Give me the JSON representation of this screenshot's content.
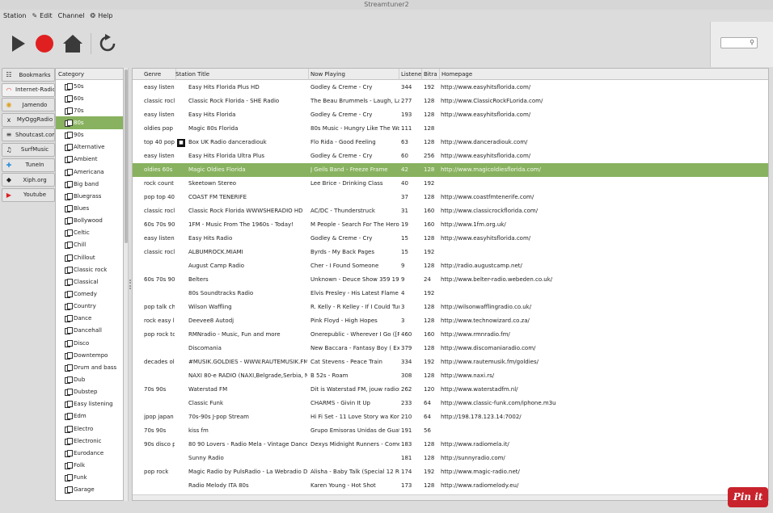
{
  "window": {
    "title": "Streamtuner2"
  },
  "menu": [
    {
      "label": "Station",
      "icon": ""
    },
    {
      "label": "Edit",
      "icon": "edit-icon"
    },
    {
      "label": "Channel",
      "icon": ""
    },
    {
      "label": "Help",
      "icon": "help-icon"
    }
  ],
  "toolbar": {
    "play_icon": "play-icon",
    "record_icon": "record-icon",
    "home_icon": "home-icon",
    "reload_icon": "reload-icon"
  },
  "search": {
    "value": ""
  },
  "sidebar": {
    "items": [
      {
        "label": "Bookmarks",
        "icon": "bookmarks-icon",
        "glyph": "☷"
      },
      {
        "label": "Internet-Radio",
        "icon": "internet-radio-icon",
        "glyph": "◠"
      },
      {
        "label": "Jamendo",
        "icon": "jamendo-icon",
        "glyph": "◉"
      },
      {
        "label": "MyOggRadio",
        "icon": "myoggradio-icon",
        "glyph": "x"
      },
      {
        "label": "Shoutcast.com",
        "icon": "shoutcast-icon",
        "glyph": "≡"
      },
      {
        "label": "SurfMusic",
        "icon": "surfmusic-icon",
        "glyph": "♫"
      },
      {
        "label": "TuneIn",
        "icon": "tunein-icon",
        "glyph": "✚"
      },
      {
        "label": "Xiph.org",
        "icon": "xiph-icon",
        "glyph": "◆"
      },
      {
        "label": "Youtube",
        "icon": "youtube-icon",
        "glyph": "▶"
      }
    ]
  },
  "categories": {
    "header": "Category",
    "items": [
      "50s",
      "60s",
      "70s",
      "80s",
      "90s",
      "Alternative",
      "Ambient",
      "Americana",
      "Big band",
      "Bluegrass",
      "Blues",
      "Bollywood",
      "Celtic",
      "Chill",
      "Chillout",
      "Classic rock",
      "Classical",
      "Comedy",
      "Country",
      "Dance",
      "Dancehall",
      "Disco",
      "Downtempo",
      "Drum and bass",
      "Dub",
      "Dubstep",
      "Easy listening",
      "Edm",
      "Electro",
      "Electronic",
      "Eurodance",
      "Folk",
      "Funk",
      "Garage"
    ],
    "selected": "80s"
  },
  "stations": {
    "columns": {
      "genre": "Genre",
      "title": "Station Title",
      "playing": "Now Playing",
      "listeners": "Listene",
      "bitrate": "Bitra",
      "homepage": "Homepage"
    },
    "rows": [
      {
        "genre": "easy listen",
        "title": "Easy Hits Florida Plus HD",
        "playing": "Godley & Creme - Cry",
        "listeners": "344",
        "bitrate": "192",
        "homepage": "http://www.easyhitsflorida.com/"
      },
      {
        "genre": "classic rocl",
        "title": "Classic Rock Florida - SHE Radio",
        "playing": "The Beau Brummels - Laugh, La",
        "listeners": "277",
        "bitrate": "128",
        "homepage": "http://www.ClassicRockFLorida.com/"
      },
      {
        "genre": "easy listen",
        "title": "Easy Hits Florida",
        "playing": "Godley & Creme - Cry",
        "listeners": "193",
        "bitrate": "128",
        "homepage": "http://www.easyhitsflorida.com/"
      },
      {
        "genre": "oldies pop",
        "title": "Magic 80s Florida",
        "playing": "80s Music - Hungry Like The Wol",
        "listeners": "111",
        "bitrate": "128",
        "homepage": ""
      },
      {
        "genre": "top 40 pop",
        "title": "Box UK Radio danceradiouk",
        "playing": "Flo Rida - Good Feeling",
        "listeners": "63",
        "bitrate": "128",
        "homepage": "http://www.danceradiouk.com/",
        "favicon": true
      },
      {
        "genre": "easy listen",
        "title": "Easy Hits Florida Ultra Plus",
        "playing": "Godley & Creme - Cry",
        "listeners": "60",
        "bitrate": "256",
        "homepage": "http://www.easyhitsflorida.com/"
      },
      {
        "genre": "oldies 60s",
        "title": "Magic Oldies Florida",
        "playing": "J Geils Band - Freeze Frame",
        "listeners": "42",
        "bitrate": "128",
        "homepage": "http://www.magicoldiesflorida.com/",
        "selected": true
      },
      {
        "genre": "rock count",
        "title": "Skeetown Stereo",
        "playing": "Lee Brice - Drinking Class",
        "listeners": "40",
        "bitrate": "192",
        "homepage": ""
      },
      {
        "genre": "pop top 40",
        "title": "COAST FM TENERIFE",
        "playing": "",
        "listeners": "37",
        "bitrate": "128",
        "homepage": "http://www.coastfmtenerife.com/"
      },
      {
        "genre": "classic rocl",
        "title": "Classic Rock Florida WWWSHERADIO  HD",
        "playing": "AC/DC - Thunderstruck",
        "listeners": "31",
        "bitrate": "160",
        "homepage": "http://www.classicrockflorida.com/"
      },
      {
        "genre": "60s 70s 90",
        "title": "1FM - Music From The 1960s - Today!",
        "playing": "M People - Search For The Hero",
        "listeners": "19",
        "bitrate": "160",
        "homepage": "http://www.1fm.org.uk/"
      },
      {
        "genre": "easy listen",
        "title": "Easy Hits Radio",
        "playing": "Godley & Creme - Cry",
        "listeners": "15",
        "bitrate": "128",
        "homepage": "http://www.easyhitsflorida.com/"
      },
      {
        "genre": "classic rocl",
        "title": "ALBUMROCK.MIAMI",
        "playing": "Byrds - My Back Pages",
        "listeners": "15",
        "bitrate": "192",
        "homepage": ""
      },
      {
        "genre": "",
        "title": "August Camp Radio",
        "playing": "Cher - I Found Someone",
        "listeners": "9",
        "bitrate": "128",
        "homepage": "http://radio.augustcamp.net/"
      },
      {
        "genre": "60s 70s 90",
        "title": "Belters",
        "playing": "Unknown - Deuce Show 359 192",
        "listeners": "9",
        "bitrate": "24",
        "homepage": "http://www.belter-radio.webeden.co.uk/"
      },
      {
        "genre": "",
        "title": "80s Soundtracks Radio",
        "playing": "Elvis Presley - His Latest Flame (",
        "listeners": "4",
        "bitrate": "192",
        "homepage": ""
      },
      {
        "genre": "pop talk ch",
        "title": "Wilson Waffling",
        "playing": "R. Kelly - R Kelley - If I Could Turn",
        "listeners": "3",
        "bitrate": "128",
        "homepage": "http://wilsonwafflingradio.co.uk/"
      },
      {
        "genre": "rock easy l",
        "title": "Deevee8 Autodj",
        "playing": "Pink Floyd - High Hopes",
        "listeners": "3",
        "bitrate": "128",
        "homepage": "http://www.technowizard.co.za/"
      },
      {
        "genre": "pop rock tc",
        "title": "RMNradio - Music, Fun and more",
        "playing": "Onerepublic - Wherever I Go ([RI",
        "listeners": "460",
        "bitrate": "160",
        "homepage": "http://www.rmnradio.fm/"
      },
      {
        "genre": "",
        "title": "Discomania",
        "playing": "New Baccara - Fantasy Boy ( Exte",
        "listeners": "379",
        "bitrate": "128",
        "homepage": "http://www.discomaniaradio.com/"
      },
      {
        "genre": "decades ol",
        "title": "#MUSIK.GOLDIES - WWW.RAUTEMUSIK.FM",
        "playing": "Cat Stevens - Peace Train",
        "listeners": "334",
        "bitrate": "192",
        "homepage": "http://www.rautemusik.fm/goldies/"
      },
      {
        "genre": "",
        "title": "NAXI 80-e RADIO (NAXI,Belgrade,Serbia, NA",
        "playing": "B 52s - Roam",
        "listeners": "308",
        "bitrate": "128",
        "homepage": "http://www.naxi.rs/"
      },
      {
        "genre": "70s 90s",
        "title": "Waterstad FM",
        "playing": "Dit is Waterstad FM, jouw radiost",
        "listeners": "262",
        "bitrate": "120",
        "homepage": "http://www.waterstadfm.nl/"
      },
      {
        "genre": "",
        "title": "Classic Funk",
        "playing": "CHARMS - Givin It Up",
        "listeners": "233",
        "bitrate": "64",
        "homepage": "http://www.classic-funk.com/iphone.m3u"
      },
      {
        "genre": "jpop japan",
        "title": "70s-90s J-pop Stream",
        "playing": "Hi Fi Set - 11 Love Story wa Korek",
        "listeners": "210",
        "bitrate": "64",
        "homepage": "http://198.178.123.14:7002/"
      },
      {
        "genre": "70s 90s",
        "title": "kiss fm",
        "playing": "Grupo Emisoras Unidas de Guate",
        "listeners": "191",
        "bitrate": "56",
        "homepage": ""
      },
      {
        "genre": "90s disco p",
        "title": "80 90 Lovers - Radio Mela - Vintage Dance -",
        "playing": "Dexys Midnight Runners - Come",
        "listeners": "183",
        "bitrate": "128",
        "homepage": "http://www.radiomela.it/"
      },
      {
        "genre": "",
        "title": "Sunny Radio",
        "playing": "",
        "listeners": "181",
        "bitrate": "128",
        "homepage": "http://sunnyradio.com/"
      },
      {
        "genre": "pop rock",
        "title": "Magic Radio by PulsRadio - La Webradio Des",
        "playing": "Alisha - Baby Talk (Special 12 Re",
        "listeners": "174",
        "bitrate": "192",
        "homepage": "http://www.magic-radio.net/"
      },
      {
        "genre": "",
        "title": "Radio Melody ITA 80s",
        "playing": "Karen Young - Hot Shot",
        "listeners": "173",
        "bitrate": "128",
        "homepage": "http://www.radiomelody.eu/"
      }
    ]
  },
  "pin_button": {
    "label": "Pin it"
  },
  "colors": {
    "selection": "#88b25f",
    "record": "#e02020",
    "pin": "#c8232c"
  }
}
